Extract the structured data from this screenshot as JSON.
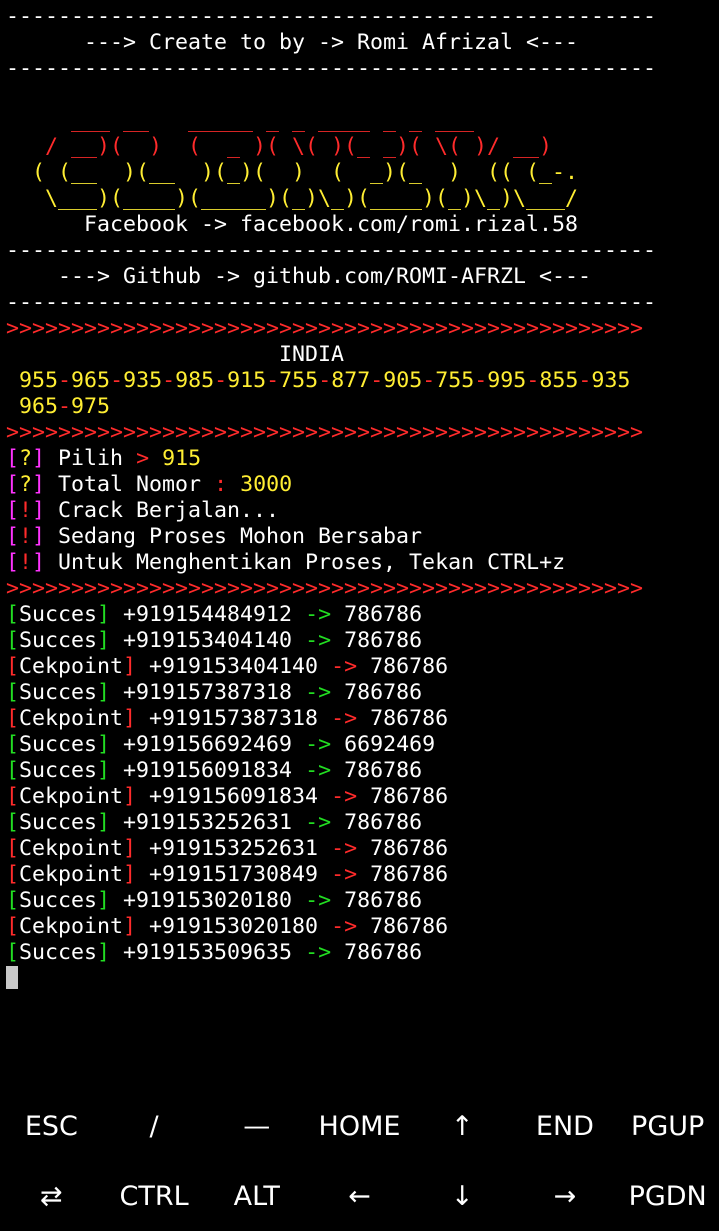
{
  "terminal": {
    "rule": "--------------------------------------------------",
    "credit": "      ---> Create to by -> Romi Afrizal <---",
    "ascii_art": [
      "     ___ __   _____ _ _ ____ _ _ ___",
      "   / __)(  )  (  _ )( \\( )(_ _)( \\( )/ __)",
      "  ( (__  )(__  )(_)(  )  (  _)(_  )  (( (_-.",
      "   \\___)(____)(_____)(_)\\_)(____)(_)\\_)\\___/"
    ],
    "facebook": "      Facebook -> facebook.com/romi.rizal.58",
    "github": "    ---> Github -> github.com/ROMI-AFRZL <---",
    "arrows": ">>>>>>>>>>>>>>>>>>>>>>>>>>>>>>>>>>>>>>>>>>>>>>>>>",
    "country": "                     INDIA",
    "codes_line1": [
      "955",
      "965",
      "935",
      "985",
      "915",
      "755",
      "877",
      "905",
      "755",
      "995",
      "855",
      "935"
    ],
    "codes_line2": [
      "965",
      "975"
    ],
    "dash": "-",
    "prompts": [
      {
        "tag": "[?]",
        "label": " Pilih ",
        "sep": ">",
        "value": " 915"
      },
      {
        "tag": "[?]",
        "label": " Total Nomor ",
        "sep": ":",
        "value": " 3000"
      },
      {
        "tag": "[!]",
        "label": " Crack Berjalan...",
        "sep": "",
        "value": ""
      },
      {
        "tag": "[!]",
        "label": " Sedang Proses Mohon Bersabar",
        "sep": "",
        "value": ""
      },
      {
        "tag": "[!]",
        "label": " Untuk Menghentikan Proses, Tekan CTRL+z",
        "sep": "",
        "value": ""
      }
    ],
    "results": [
      {
        "status": "Succes",
        "number": "+919154484912",
        "password": "786786"
      },
      {
        "status": "Succes",
        "number": "+919153404140",
        "password": "786786"
      },
      {
        "status": "Cekpoint",
        "number": "+919153404140",
        "password": "786786"
      },
      {
        "status": "Succes",
        "number": "+919157387318",
        "password": "786786"
      },
      {
        "status": "Cekpoint",
        "number": "+919157387318",
        "password": "786786"
      },
      {
        "status": "Succes",
        "number": "+919156692469",
        "password": "6692469"
      },
      {
        "status": "Succes",
        "number": "+919156091834",
        "password": "786786"
      },
      {
        "status": "Cekpoint",
        "number": "+919156091834",
        "password": "786786"
      },
      {
        "status": "Succes",
        "number": "+919153252631",
        "password": "786786"
      },
      {
        "status": "Cekpoint",
        "number": "+919153252631",
        "password": "786786"
      },
      {
        "status": "Cekpoint",
        "number": "+919151730849",
        "password": "786786"
      },
      {
        "status": "Succes",
        "number": "+919153020180",
        "password": "786786"
      },
      {
        "status": "Cekpoint",
        "number": "+919153020180",
        "password": "786786"
      },
      {
        "status": "Succes",
        "number": "+919153509635",
        "password": "786786"
      }
    ],
    "arrow_sep": "->"
  },
  "extra_keys": {
    "row1": [
      "ESC",
      "/",
      "—",
      "HOME",
      "↑",
      "END",
      "PGUP"
    ],
    "row2": [
      "⇄",
      "CTRL",
      "ALT",
      "←",
      "↓",
      "→",
      "PGDN"
    ]
  },
  "colors": {
    "success": "#22dd22",
    "checkpoint": "#ff2b2b",
    "highlight": "#ffee33",
    "prompt_tag": "#ff33ff",
    "background": "#000000"
  }
}
